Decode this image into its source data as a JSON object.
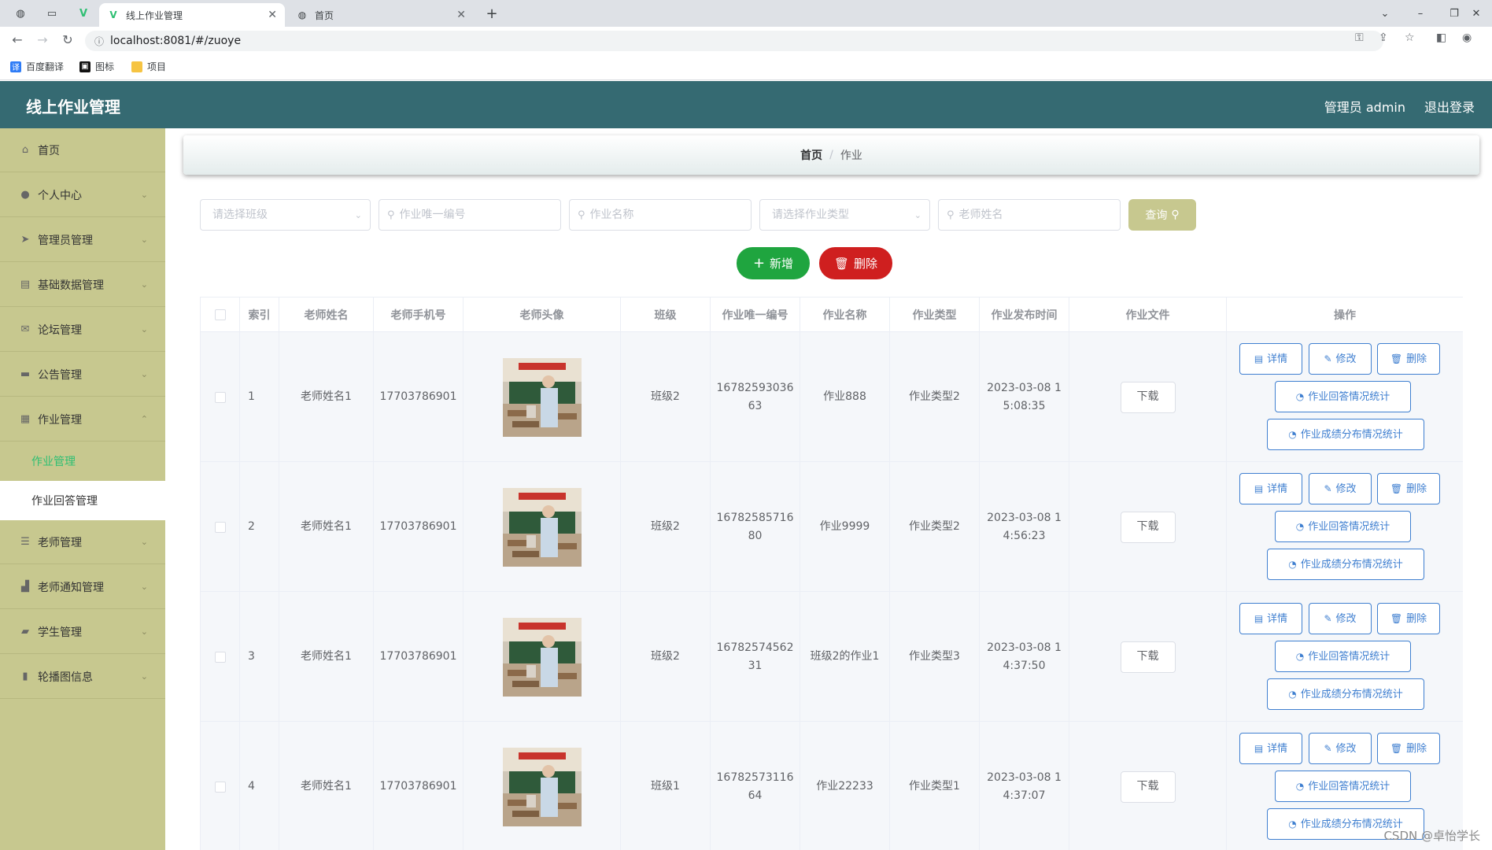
{
  "browser": {
    "tabs": [
      {
        "label": "线上作业管理",
        "active": true
      },
      {
        "label": "首页",
        "active": false
      }
    ],
    "new_tab": "+",
    "url": "localhost:8081/#/zuoye",
    "bookmarks": [
      "百度翻译",
      "图标",
      "项目"
    ]
  },
  "header": {
    "title": "线上作业管理",
    "admin": "管理员 admin",
    "logout": "退出登录"
  },
  "sidebar": {
    "items": [
      {
        "label": "首页",
        "icon": "home-icon"
      },
      {
        "label": "个人中心",
        "icon": "user-icon"
      },
      {
        "label": "管理员管理",
        "icon": "send-icon"
      },
      {
        "label": "基础数据管理",
        "icon": "data-icon"
      },
      {
        "label": "论坛管理",
        "icon": "mail-icon"
      },
      {
        "label": "公告管理",
        "icon": "chat-icon"
      },
      {
        "label": "作业管理",
        "icon": "grid-icon"
      },
      {
        "label": "老师管理",
        "icon": "list-icon"
      },
      {
        "label": "老师通知管理",
        "icon": "bell-icon"
      },
      {
        "label": "学生管理",
        "icon": "suitcase-icon"
      },
      {
        "label": "轮播图信息",
        "icon": "chart-icon"
      }
    ],
    "sub_items": [
      {
        "label": "作业管理",
        "active": true
      },
      {
        "label": "作业回答管理",
        "active": false
      }
    ]
  },
  "breadcrumb": {
    "home": "首页",
    "separator": "/",
    "current": "作业"
  },
  "search": {
    "class_placeholder": "请选择班级",
    "id_placeholder": "作业唯一编号",
    "name_placeholder": "作业名称",
    "type_placeholder": "请选择作业类型",
    "teacher_placeholder": "老师姓名",
    "query_label": "查询"
  },
  "actions": {
    "add_label": "新增",
    "delete_label": "删除"
  },
  "table": {
    "headers": [
      "索引",
      "老师姓名",
      "老师手机号",
      "老师头像",
      "班级",
      "作业唯一编号",
      "作业名称",
      "作业类型",
      "作业发布时间",
      "作业文件",
      "操作"
    ],
    "rows": [
      {
        "index": "1",
        "teacher": "老师姓名1",
        "phone": "17703786901",
        "class": "班级2",
        "code_1": "16782593036",
        "code_2": "63",
        "name": "作业888",
        "type": "作业类型2",
        "time_1": "2023-03-08 1",
        "time_2": "5:08:35"
      },
      {
        "index": "2",
        "teacher": "老师姓名1",
        "phone": "17703786901",
        "class": "班级2",
        "code_1": "16782585716",
        "code_2": "80",
        "name": "作业9999",
        "type": "作业类型2",
        "time_1": "2023-03-08 1",
        "time_2": "4:56:23"
      },
      {
        "index": "3",
        "teacher": "老师姓名1",
        "phone": "17703786901",
        "class": "班级2",
        "code_1": "16782574562",
        "code_2": "31",
        "name": "班级2的作业1",
        "type": "作业类型3",
        "time_1": "2023-03-08 1",
        "time_2": "4:37:50"
      },
      {
        "index": "4",
        "teacher": "老师姓名1",
        "phone": "17703786901",
        "class": "班级1",
        "code_1": "16782573116",
        "code_2": "64",
        "name": "作业22233",
        "type": "作业类型1",
        "time_1": "2023-03-08 1",
        "time_2": "4:37:07"
      }
    ],
    "download_label": "下载",
    "row_actions": {
      "detail": "详情",
      "edit": "修改",
      "delete": "删除",
      "answer_stats": "作业回答情况统计",
      "score_stats": "作业成绩分布情况统计"
    }
  },
  "watermark": "CSDN @卓怡学长",
  "colors": {
    "header": "#356a72",
    "sidebar": "#c7c88f",
    "active_menu": "#2fbf73",
    "primary": "#3f7fd0",
    "success": "#1fa53f",
    "danger": "#cf1f1f"
  }
}
